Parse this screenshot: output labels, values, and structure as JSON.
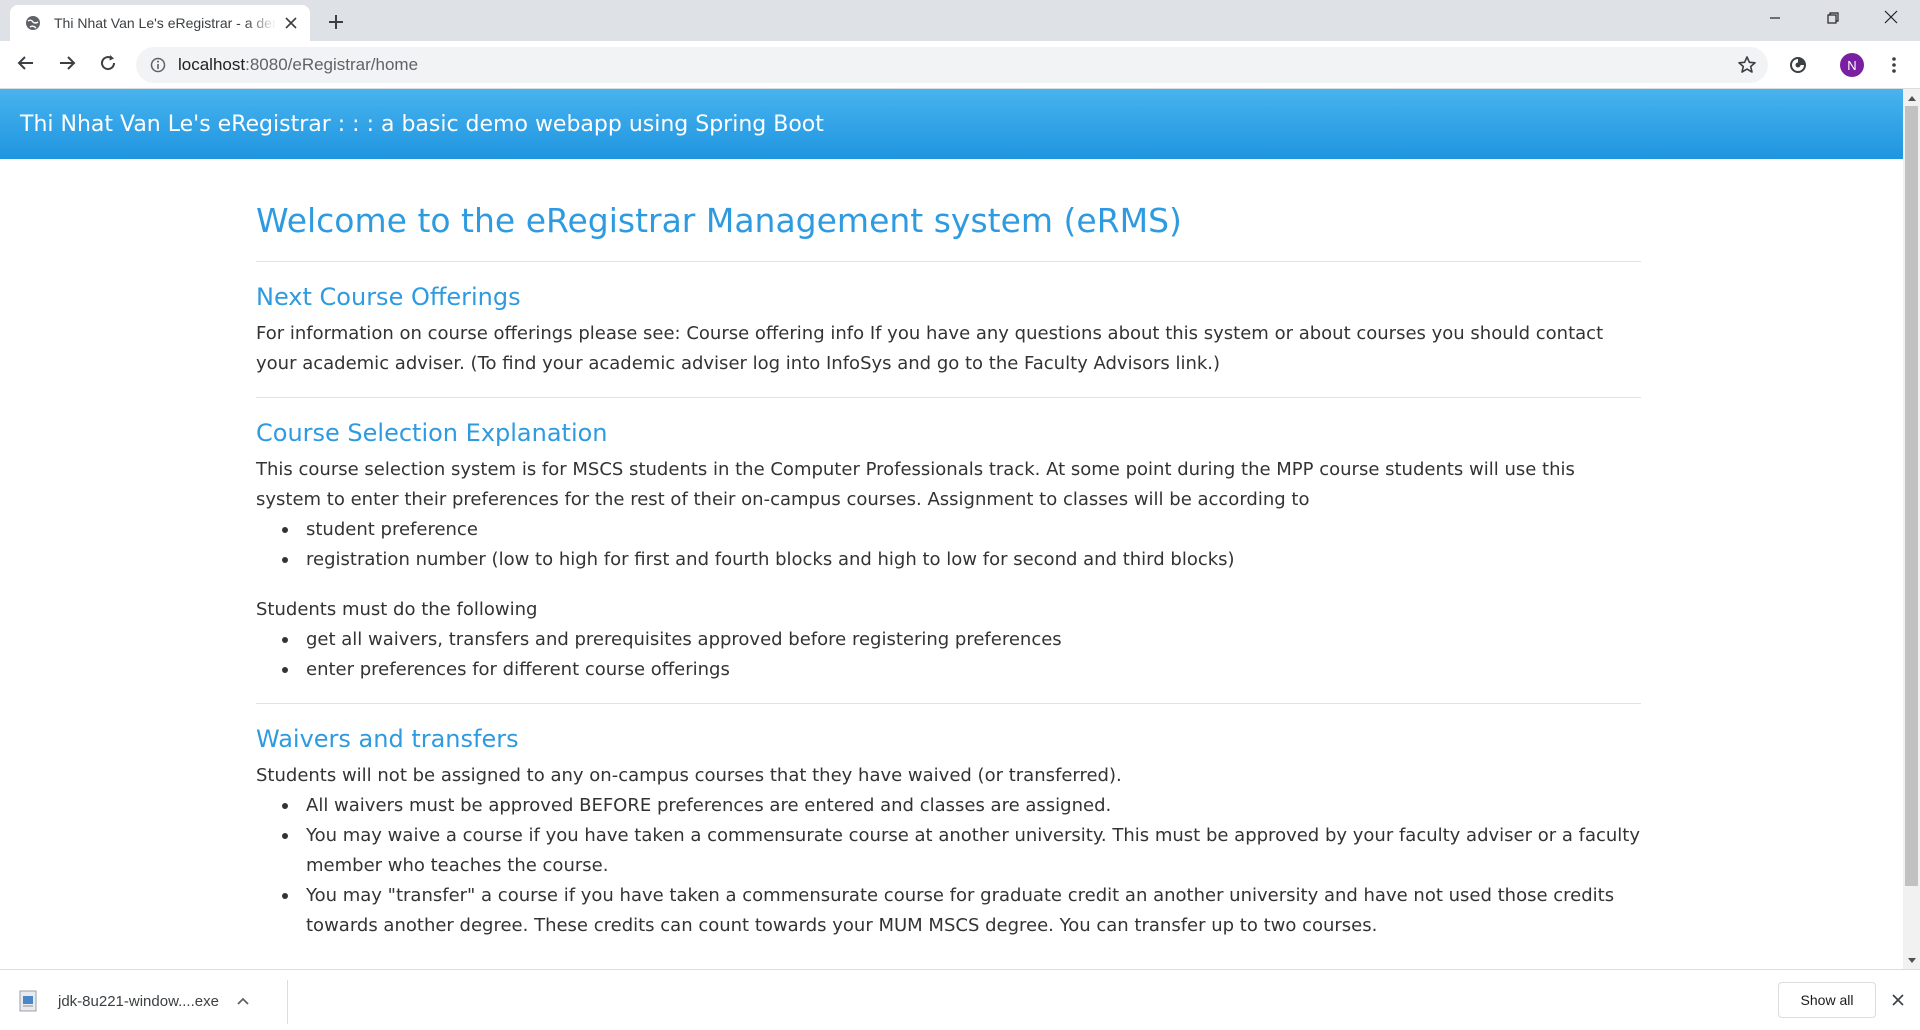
{
  "browser": {
    "tab_title": "Thi Nhat Van Le's eRegistrar - a demo webapp",
    "url_host": "localhost",
    "url_rest": ":8080/eRegistrar/home",
    "profile_initial": "N",
    "icons": [
      "globe-icon",
      "close-icon",
      "plus-icon",
      "minimize-icon",
      "restore-icon",
      "back-arrow-icon",
      "forward-arrow-icon",
      "reload-icon",
      "info-icon",
      "star-icon",
      "extension-icon",
      "kebab-menu-icon"
    ]
  },
  "site": {
    "header_title": "Thi Nhat Van Le's eRegistrar : : : a basic demo webapp using Spring Boot",
    "header_color": "#2a9fe6",
    "heading_color": "#2e9be0"
  },
  "page": {
    "title": "Welcome to the eRegistrar Management system (eRMS)",
    "sections": {
      "next_offerings": {
        "heading": "Next Course Offerings",
        "text": "For information on course offerings please see: Course offering info If you have any questions about this system or about courses you should contact your academic adviser. (To find your academic adviser log into InfoSys and go to the Faculty Advisors link.)"
      },
      "course_selection": {
        "heading": "Course Selection Explanation",
        "text": "This course selection system is for MSCS students in the Computer Professionals track. At some point during the MPP course students will use this system to enter their preferences for the rest of their on-campus courses. Assignment to classes will be according to",
        "criteria": [
          "student preference",
          "registration number (low to high for first and fourth blocks and high to low for second and third blocks)"
        ],
        "must_text": "Students must do the following",
        "must_items": [
          "get all waivers, transfers and prerequisites approved before registering preferences",
          "enter preferences for different course offerings"
        ]
      },
      "waivers": {
        "heading": "Waivers and transfers",
        "text": "Students will not be assigned to any on-campus courses that they have waived (or transferred).",
        "items": [
          "All waivers must be approved BEFORE preferences are entered and classes are assigned.",
          "You may waive a course if you have taken a commensurate course at another university. This must be approved by your faculty adviser or a faculty member who teaches the course.",
          "You may \"transfer\" a course if you have taken a commensurate course for graduate credit an another university and have not used those credits towards another degree. These credits can count towards your MUM MSCS degree. You can transfer up to two courses."
        ]
      }
    }
  },
  "downloads": {
    "file_name": "jdk-8u221-window....exe",
    "show_all_label": "Show all"
  }
}
